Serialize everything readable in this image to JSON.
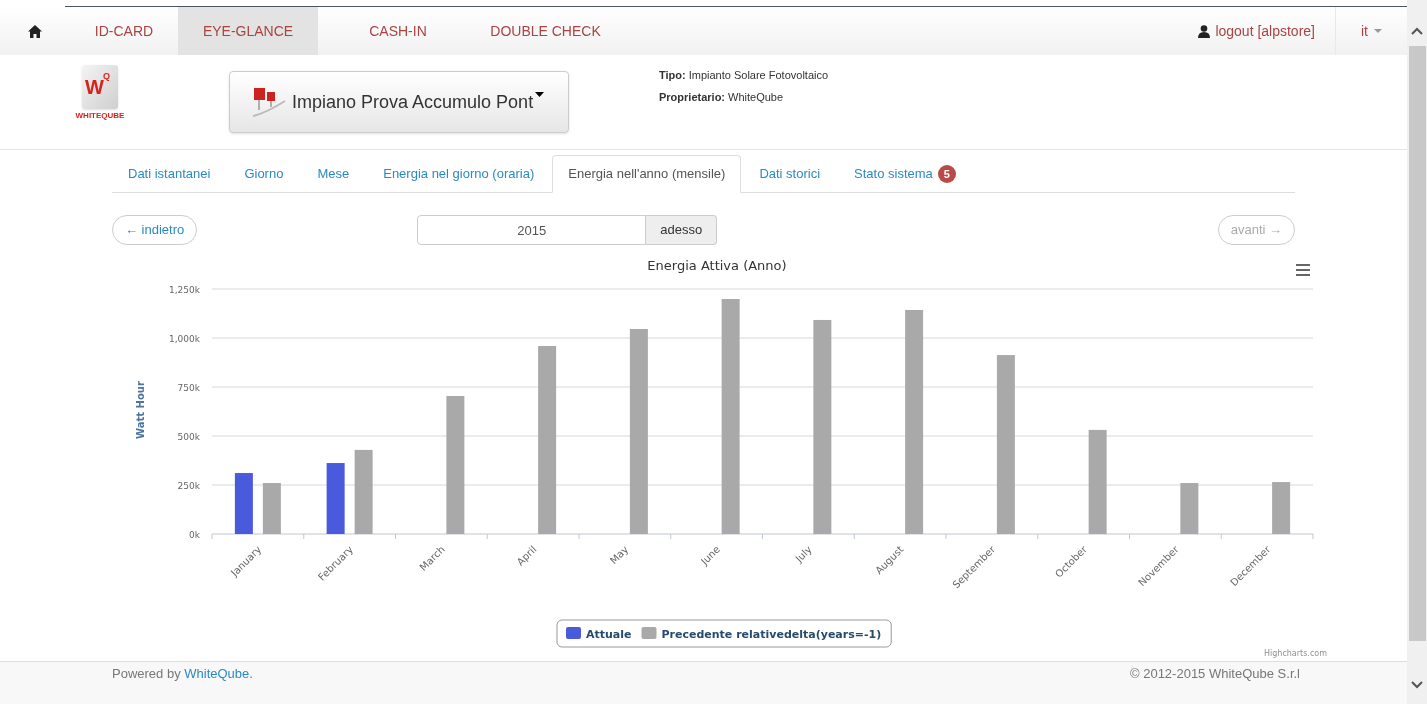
{
  "nav": {
    "items": [
      {
        "label": "ID-CARD",
        "selected": false
      },
      {
        "label": "EYE-GLANCE",
        "selected": true
      },
      {
        "label": "CASH-IN",
        "selected": false
      },
      {
        "label": "DOUBLE CHECK",
        "selected": false
      }
    ],
    "user": "logout [alpstore]",
    "language": "it"
  },
  "header": {
    "logo": {
      "mark": "W",
      "sup": "Q",
      "name": "WHITEQUBE"
    },
    "plant": "Impiano Prova Accumulo Pont",
    "info": [
      {
        "label": "Tipo:",
        "value": "Impianto Solare Fotovoltaico"
      },
      {
        "label": "Proprietario:",
        "value": "WhiteQube"
      }
    ]
  },
  "tabs": [
    {
      "label": "Dati istantanei",
      "selected": false
    },
    {
      "label": "Giorno",
      "selected": false
    },
    {
      "label": "Mese",
      "selected": false
    },
    {
      "label": "Energia nel giorno (oraria)",
      "selected": false
    },
    {
      "label": "Energia nell'anno (mensile)",
      "selected": true
    },
    {
      "label": "Dati storici",
      "selected": false
    },
    {
      "label": "Stato sistema",
      "selected": false,
      "badge": "5"
    }
  ],
  "controls": {
    "prev": {
      "label": "← indietro",
      "disabled": false
    },
    "year": "2015",
    "now": "adesso",
    "next": {
      "label": "avanti →",
      "disabled": true
    }
  },
  "chart": {
    "credit": "Highcharts.com",
    "chart_data": {
      "type": "bar",
      "title": "Energia Attiva (Anno)",
      "ylabel": "Watt Hour",
      "categories": [
        "January",
        "February",
        "March",
        "April",
        "May",
        "June",
        "July",
        "August",
        "September",
        "October",
        "November",
        "December"
      ],
      "series": [
        {
          "name": "Attuale",
          "color": "#4a5add",
          "values": [
            311000,
            362000,
            null,
            null,
            null,
            null,
            null,
            null,
            null,
            null,
            null,
            null
          ]
        },
        {
          "name": "Precedente relativedelta(years=-1)",
          "color": "#a9a9a9",
          "values": [
            260000,
            429000,
            704000,
            959000,
            1046000,
            1199000,
            1092000,
            1143000,
            913000,
            531000,
            260000,
            265000
          ]
        }
      ],
      "grid": true,
      "legend": true,
      "ylim": [
        0,
        1250000
      ],
      "yticks": [
        {
          "value": 0,
          "label": "0k"
        },
        {
          "value": 250000,
          "label": "250k"
        },
        {
          "value": 500000,
          "label": "500k"
        },
        {
          "value": 750000,
          "label": "750k"
        },
        {
          "value": 1000000,
          "label": "1,000k"
        },
        {
          "value": 1250000,
          "label": "1,250k"
        }
      ]
    }
  },
  "footer": {
    "prefix": "Powered by ",
    "link": "WhiteQube",
    "suffix": ".",
    "copyright": "© 2012-2015 WhiteQube S.r.l"
  }
}
